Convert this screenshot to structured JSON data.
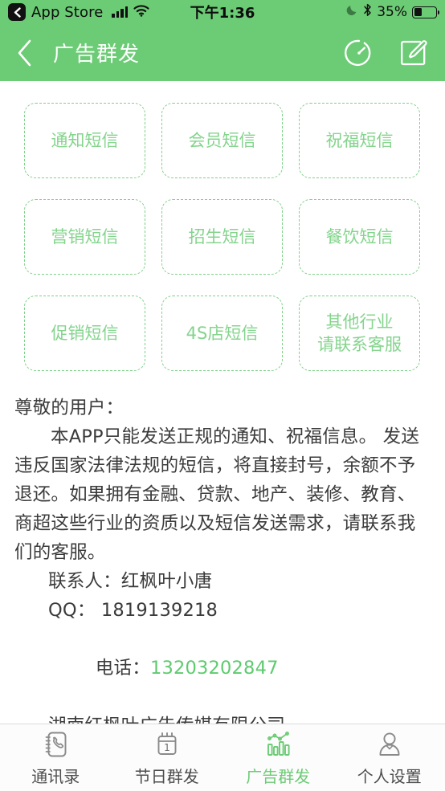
{
  "status_bar": {
    "back_label": "App Store",
    "back_icon": "chevron-left-icon",
    "signal_icon": "signal-bars-icon",
    "wifi_icon": "wifi-icon",
    "time": "下午1:36",
    "moon_icon": "moon-icon",
    "bluetooth_icon": "bluetooth-icon",
    "battery_percent": "35%",
    "battery_level": 35,
    "battery_icon": "battery-icon"
  },
  "nav": {
    "back_icon": "chevron-left-icon",
    "title": "广告群发",
    "timer_icon": "timer-icon",
    "compose_icon": "compose-edit-icon",
    "bg_color": "#6ccb75"
  },
  "grid": {
    "accent_color": "#84d48d",
    "cards": [
      {
        "label": "通知短信",
        "lines": [
          "通知短信"
        ]
      },
      {
        "label": "会员短信",
        "lines": [
          "会员短信"
        ]
      },
      {
        "label": "祝福短信",
        "lines": [
          "祝福短信"
        ]
      },
      {
        "label": "营销短信",
        "lines": [
          "营销短信"
        ]
      },
      {
        "label": "招生短信",
        "lines": [
          "招生短信"
        ]
      },
      {
        "label": "餐饮短信",
        "lines": [
          "餐饮短信"
        ]
      },
      {
        "label": "促销短信",
        "lines": [
          "促销短信"
        ]
      },
      {
        "label": "4S店短信",
        "lines": [
          "4S店短信"
        ]
      },
      {
        "label": "其他行业请联系客服",
        "lines": [
          "其他行业",
          "请联系客服"
        ]
      }
    ]
  },
  "notice": {
    "salutation": "尊敬的用户：",
    "body": "本APP只能发送正规的通知、祝福信息。 发送违反国家法律法规的短信，将直接封号，余额不予退还。如果拥有金融、贷款、地产、装修、教育、商超这些行业的资质以及短信发送需求，请联系我们的客服。",
    "contact_person": "联系人：红枫叶小唐",
    "qq": "QQ： 1819139218",
    "phone_label": "电话：",
    "phone_number": "13203202847",
    "phone_color": "#5ecb6e",
    "company": "湖南红枫叶广告传媒有限公司"
  },
  "tabbar": {
    "active_color": "#6ccb75",
    "inactive_color": "#4d4d4d",
    "items": [
      {
        "label": "通讯录",
        "icon": "contacts-book-icon",
        "active": false
      },
      {
        "label": "节日群发",
        "icon": "calendar-icon",
        "active": false
      },
      {
        "label": "广告群发",
        "icon": "bar-chart-icon",
        "active": true
      },
      {
        "label": "个人设置",
        "icon": "person-icon",
        "active": false
      }
    ]
  }
}
